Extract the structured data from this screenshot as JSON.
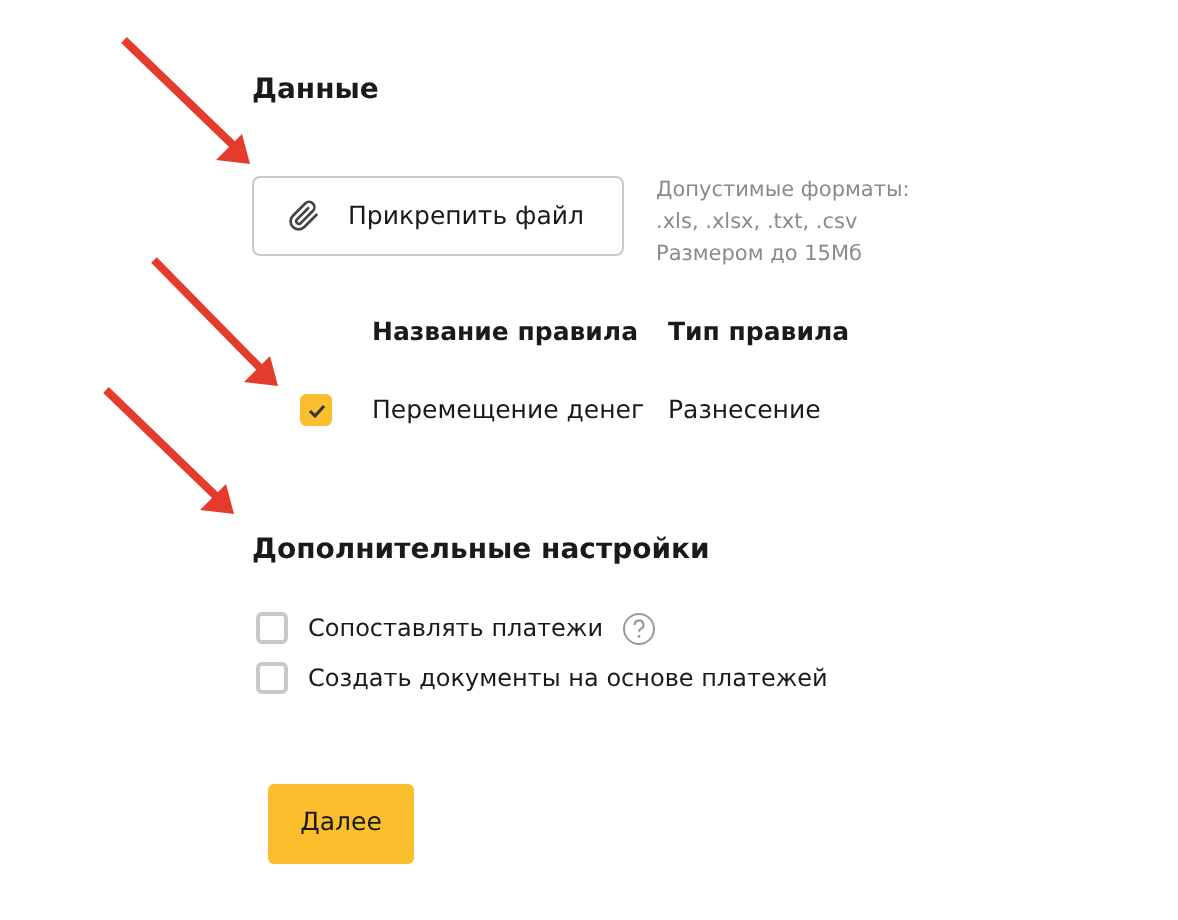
{
  "data_section": {
    "title": "Данные",
    "attach_button": "Прикрепить файл",
    "hint": [
      "Допустимые форматы:",
      ".xls, .xlsx, .txt, .csv",
      "Размером до 15Мб"
    ]
  },
  "rules_table": {
    "columns": [
      "Название правила",
      "Тип правила"
    ],
    "rows": [
      {
        "checked": true,
        "name": "Перемещение денег",
        "type": "Разнесение"
      }
    ]
  },
  "extra_settings": {
    "title": "Дополнительные настройки",
    "options": [
      {
        "label": "Сопоставлять платежи",
        "checked": false,
        "help": true
      },
      {
        "label": "Создать документы на основе платежей",
        "checked": false,
        "help": false
      }
    ]
  },
  "next_button": "Далее"
}
